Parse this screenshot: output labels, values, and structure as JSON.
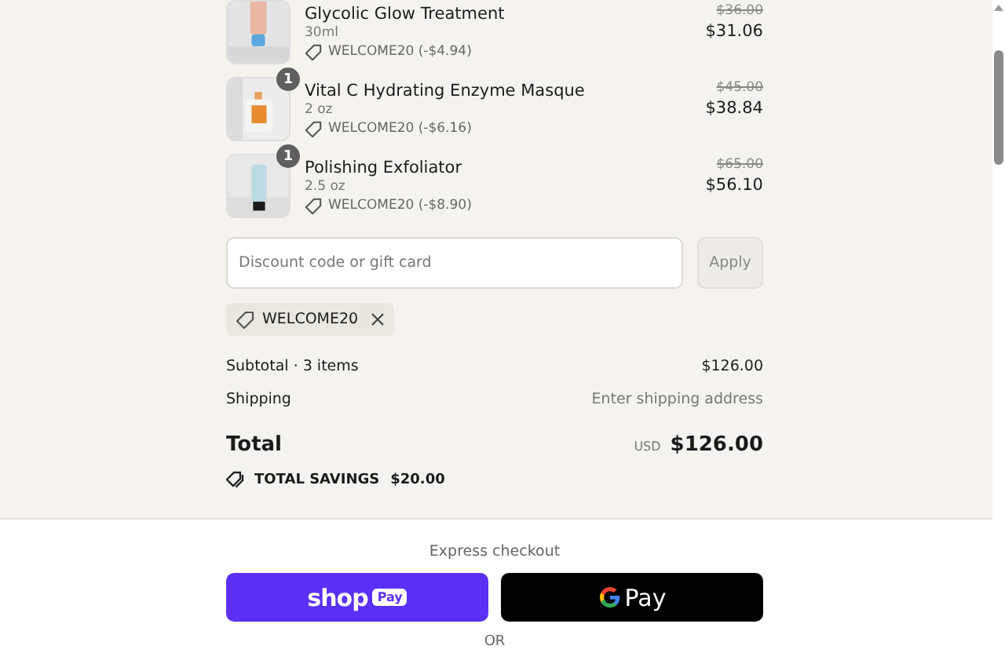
{
  "items": [
    {
      "name": "Glycolic Glow Treatment",
      "variant": "30ml",
      "discount": "WELCOME20 (-$4.94)",
      "original_price": "$36.00",
      "price": "$31.06"
    },
    {
      "name": "Vital C Hydrating Enzyme Masque",
      "variant": "2 oz",
      "discount": "WELCOME20 (-$6.16)",
      "original_price": "$45.00",
      "price": "$38.84",
      "quantity": "1"
    },
    {
      "name": "Polishing Exfoliator",
      "variant": "2.5 oz",
      "discount": "WELCOME20 (-$8.90)",
      "original_price": "$65.00",
      "price": "$56.10",
      "quantity": "1"
    }
  ],
  "discount_field": {
    "placeholder": "Discount code or gift card"
  },
  "apply_button": {
    "label": "Apply",
    "disabled": true
  },
  "applied_codes": [
    {
      "code": "WELCOME20"
    }
  ],
  "summary": {
    "subtotal_label": "Subtotal · 3 items",
    "subtotal": "$126.00",
    "shipping_label": "Shipping",
    "shipping": "Enter shipping address",
    "total_label": "Total",
    "currency": "USD",
    "total": "$126.00",
    "savings_label": "TOTAL SAVINGS",
    "savings": "$20.00"
  },
  "express": {
    "title": "Express checkout",
    "buttons": [
      {
        "kind": "shop_pay",
        "text": "shop",
        "badge": "Pay"
      },
      {
        "kind": "google_pay",
        "text": "Pay"
      }
    ],
    "separator": "OR"
  }
}
